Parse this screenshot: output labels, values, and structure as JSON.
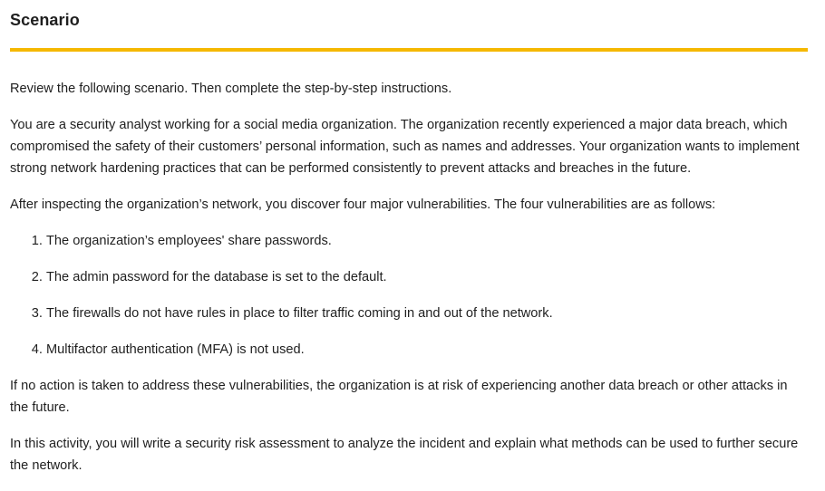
{
  "section": {
    "heading": "Scenario"
  },
  "body": {
    "intro": "Review the following scenario. Then complete the step-by-step instructions.",
    "paragraph1": "You are a security analyst working for a social media organization. The organization recently experienced a major data breach, which compromised the safety of their customers’ personal information, such as names and addresses. Your organization wants to implement strong network hardening practices that can be performed consistently to prevent attacks and breaches in the future.",
    "paragraph2": "After inspecting the organization’s network, you discover four major vulnerabilities. The four vulnerabilities are as follows:",
    "vulnerabilities": [
      "The organization’s employees' share passwords.",
      "The admin password for the database is set to the default.",
      "The firewalls do not have rules in place to filter traffic coming in and out of the network.",
      "Multifactor authentication (MFA) is not used."
    ],
    "paragraph3": "If no action is taken to address these vulnerabilities, the organization is at risk of experiencing another data breach or other attacks in the future.",
    "paragraph4": "In this activity, you will write a security risk assessment to analyze the incident and explain what methods can be used to further secure the network."
  },
  "colors": {
    "accent_rule": "#f5b800",
    "text": "#1f1f1f"
  }
}
